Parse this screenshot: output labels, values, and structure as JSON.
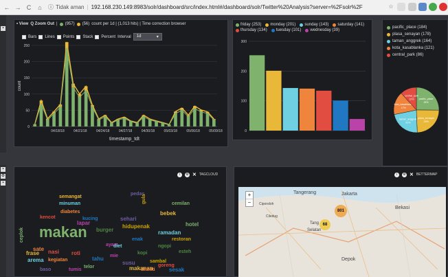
{
  "browser": {
    "insecure_label": "Tidak aman",
    "url": "192.168.230.149:8983/solr/dashboard/src/index.html#/dashboard/solr/Twitter%20Analysis?server=%2Fsolr%2F",
    "nav": [
      "←",
      "→",
      "C",
      "⌂"
    ]
  },
  "histogram": {
    "view_label": "• View",
    "zoom_out_label": "Q Zoom Out",
    "series": [
      {
        "label": "(957)",
        "color": "#7eb26d"
      },
      {
        "label": "(56)",
        "color": "#eab839"
      }
    ],
    "count_text": "count per 1d | (1,013 hits) | Time correction browser",
    "options": {
      "bars": "Bars",
      "lines": "Lines",
      "points": "Points",
      "stack": "Stack",
      "percent": "Percent",
      "interval_label": "Interval",
      "interval_value": "1d"
    }
  },
  "chart_data": [
    {
      "type": "bar",
      "xlabel": "timestamp_tdt",
      "ylabel": "count",
      "ylim": [
        0,
        250
      ],
      "ticks_y": [
        "0",
        "50",
        "100",
        "150",
        "200",
        "250"
      ],
      "ticks_x": [
        "04/18/18",
        "04/21/18",
        "04/24/18",
        "04/27/18",
        "04/30/18",
        "05/03/18",
        "05/06/18",
        "05/09/18"
      ],
      "series": [
        {
          "values": [
            5,
            70,
            20,
            40,
            60,
            240,
            120,
            90,
            110,
            60,
            20,
            30,
            10,
            20,
            25,
            15,
            10,
            30,
            20,
            15,
            10,
            5,
            40,
            50,
            30,
            55,
            45,
            40,
            20
          ]
        },
        {
          "values": [
            2,
            10,
            4,
            6,
            8,
            20,
            12,
            10,
            14,
            6,
            3,
            5,
            2,
            3,
            4,
            2,
            2,
            5,
            3,
            2,
            2,
            1,
            6,
            7,
            5,
            8,
            6,
            5,
            3
          ]
        }
      ]
    },
    {
      "type": "bar",
      "ylim": [
        0,
        300
      ],
      "ticks_y": [
        "0",
        "100",
        "200",
        "300"
      ],
      "categories": [
        "friday",
        "monday",
        "sunday",
        "saturday",
        "thursday",
        "tuesday",
        "wednesday"
      ],
      "values": [
        253,
        201,
        143,
        141,
        134,
        101,
        39
      ],
      "colors": [
        "#7eb26d",
        "#eab839",
        "#6ed0e0",
        "#ef843c",
        "#e24d42",
        "#1f78c1",
        "#ba43a9"
      ]
    },
    {
      "type": "pie",
      "categories": [
        "pacific_place",
        "plasa_senayan",
        "taman_anggrek",
        "kota_kasablanka",
        "central_park"
      ],
      "values": [
        184,
        178,
        164,
        121,
        86
      ],
      "colors": [
        "#7eb26d",
        "#eab839",
        "#6ed0e0",
        "#ef843c",
        "#e24d42"
      ],
      "slice_labels": [
        "pacific_place 25%",
        "plasa_senayan 24%",
        "taman_anggrek 22%",
        "kota_kasablanka 17%",
        "central_park 12%"
      ]
    }
  ],
  "weekday_legend": [
    "friday (253)",
    "monday (201)",
    "sunday (143)",
    "saturday (141)",
    "thursday (134)",
    "tuesday (101)",
    "wednesday (39)"
  ],
  "pie_legend": [
    "pacific_place (184)",
    "plasa_senayan (178)",
    "taman_anggrek (164)",
    "kota_kasablanka (121)",
    "central_park (86)"
  ],
  "tagcloud": {
    "title": "TAGCLOUD",
    "words": [
      "makan",
      "semangat",
      "minuman",
      "diabetes",
      "kencot",
      "kucing",
      "lapar",
      "sehari",
      "burger",
      "hidupenak",
      "hotel",
      "bebek",
      "ramadan",
      "sate",
      "nasi",
      "enak",
      "ayam",
      "pedas",
      "ngopi",
      "restoran",
      "ceplok",
      "frase",
      "arema",
      "kegiatan",
      "roti",
      "tahu",
      "mie",
      "susu",
      "kopi",
      "sambal",
      "telor",
      "makanan",
      "diet",
      "diteliti",
      "goreng",
      "sesak",
      "tumis",
      "baso",
      "esteh",
      "gula",
      "cemilan"
    ]
  },
  "bettermap": {
    "title": "BETTERMAP",
    "zoom_in": "+",
    "zoom_out": "−",
    "places": [
      "Tangerang",
      "Jakarta",
      "Bekasi",
      "Depok",
      "Selatan",
      "Tang",
      "Cipondoh",
      "Ciledug"
    ],
    "clusters": [
      "801",
      "68"
    ]
  },
  "colors": {
    "panel_bg": "#1a1c20",
    "green": "#7eb26d",
    "yellow": "#eab839"
  }
}
